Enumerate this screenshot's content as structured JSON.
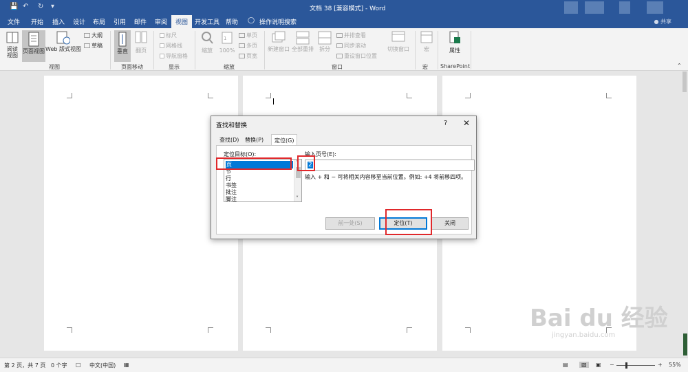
{
  "titlebar": {
    "title": "文档 38 [兼容模式] - Word",
    "qa_save_icon": "save-icon",
    "qa_undo_icon": "undo-icon",
    "qa_redo_icon": "redo-icon",
    "qa_customize_icon": "customize-icon"
  },
  "menubar": {
    "tabs": [
      "文件",
      "开始",
      "插入",
      "设计",
      "布局",
      "引用",
      "邮件",
      "审阅",
      "视图",
      "开发工具",
      "帮助"
    ],
    "active_tab": "视图",
    "tell_me": "操作说明搜索",
    "share": "共享"
  },
  "ribbon": {
    "views": {
      "read": "阅读\n视图",
      "print": "页面视图",
      "web": "Web 版式视图",
      "outline": "大纲",
      "draft": "草稿",
      "group": "视图"
    },
    "page_move": {
      "vertical": "垂直",
      "side": "翻页",
      "group": "页面移动"
    },
    "show": {
      "ruler": "标尺",
      "gridlines": "网格线",
      "nav": "导航窗格",
      "group": "显示"
    },
    "zoom": {
      "zoom": "缩放",
      "hundred": "100%",
      "one_page": "单页",
      "multi_page": "多页",
      "page_width": "页宽",
      "group": "缩放"
    },
    "window": {
      "new": "新建窗口",
      "arrange": "全部重排",
      "split": "拆分",
      "side_by_side": "并排查看",
      "sync": "同步滚动",
      "reset": "重设窗口位置",
      "switch": "切换窗口",
      "group": "窗口"
    },
    "macro": {
      "macro": "宏",
      "group": "宏"
    },
    "sharepoint": {
      "props": "属性",
      "group": "SharePoint"
    }
  },
  "dialog": {
    "title": "查找和替换",
    "help": "?",
    "close": "✕",
    "tabs": [
      "查找(D)",
      "替换(P)",
      "定位(G)"
    ],
    "target_label": "定位目标(O):",
    "targets": [
      "页",
      "节",
      "行",
      "书签",
      "批注",
      "脚注"
    ],
    "selected_target": "页",
    "input_label": "输入页号(E):",
    "input_value": "2",
    "hint": "输入 + 和 − 可将相关内容移至当前位置。例如: +4 将前移四项。",
    "prev_button": "前一处(S)",
    "goto_button": "定位(T)",
    "close_button": "关闭"
  },
  "statusbar": {
    "page": "第 2 页，共 7 页",
    "words": "0 个字",
    "lang": "中文(中国)",
    "zoom": "55%",
    "zoom_minus": "−",
    "zoom_plus": "+"
  },
  "watermark": {
    "text": "Bai du 经验",
    "sub": "jingyan.baidu.com"
  }
}
